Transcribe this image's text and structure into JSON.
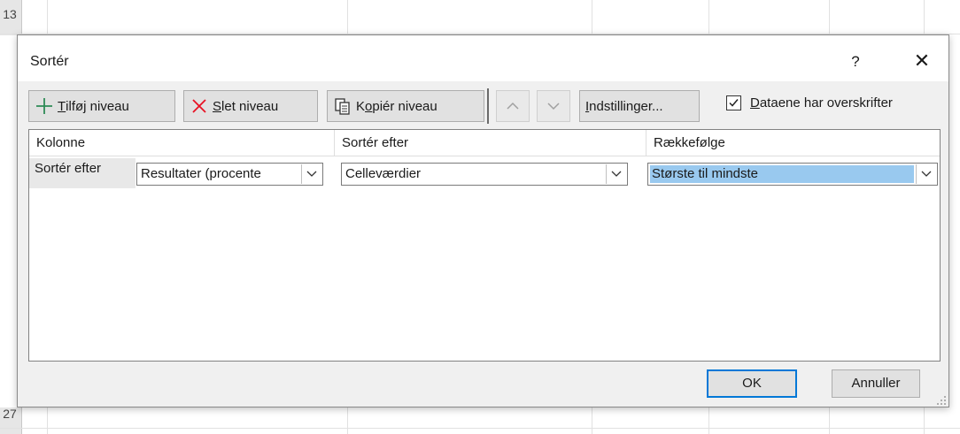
{
  "spreadsheet": {
    "row_top": "13",
    "row_bottom": "27"
  },
  "dialog": {
    "title": "Sortér",
    "help_label": "?",
    "close_label": "✕",
    "toolbar": {
      "add_first": "T",
      "add_rest": "ilføj niveau",
      "delete_first": "S",
      "delete_rest": "let niveau",
      "copy_pre": "K",
      "copy_u": "o",
      "copy_rest": "piér niveau",
      "options_first": "I",
      "options_rest": "ndstillinger...",
      "headers_first": "D",
      "headers_rest": "ataene har overskrifter",
      "headers_checked": true
    },
    "columns": {
      "column": "Kolonne",
      "sort_on": "Sortér efter",
      "order": "Rækkefølge"
    },
    "rows": [
      {
        "label": "Sortér efter",
        "column_value": "Resultater (procente",
        "sort_on_value": "Celleværdier",
        "order_value": "Største til mindste"
      }
    ],
    "ok_label": "OK",
    "cancel_label": "Annuller"
  },
  "colors": {
    "accent": "#0078d7",
    "selection": "#99c9ef",
    "add_icon": "#2e8b57",
    "delete_icon": "#e81123"
  }
}
